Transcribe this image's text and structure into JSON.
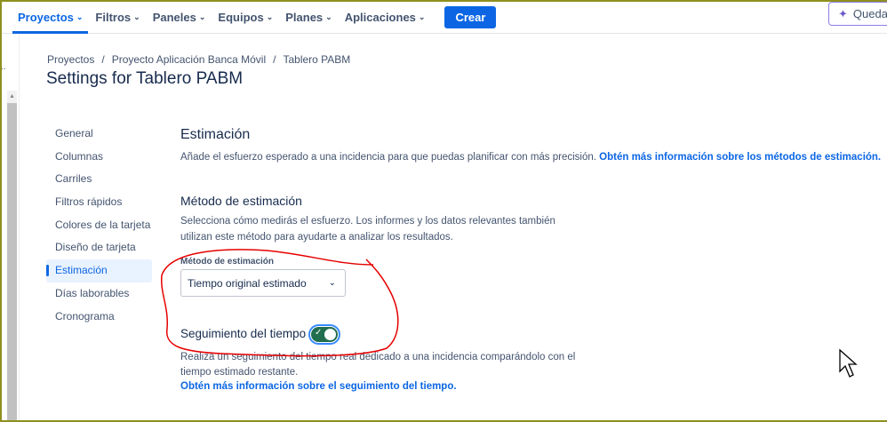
{
  "topnav": {
    "items": [
      {
        "label": "Proyectos",
        "active": true
      },
      {
        "label": "Filtros"
      },
      {
        "label": "Paneles"
      },
      {
        "label": "Equipos"
      },
      {
        "label": "Planes"
      },
      {
        "label": "Aplicaciones"
      }
    ],
    "create": "Crear",
    "quedar": "Quedar"
  },
  "breadcrumb": [
    "Proyectos",
    "Proyecto Aplicación Banca Móvil",
    "Tablero PABM"
  ],
  "title": "Settings for Tablero PABM",
  "sidebar": [
    "General",
    "Columnas",
    "Carriles",
    "Filtros rápidos",
    "Colores de la tarjeta",
    "Diseño de tarjeta",
    "Estimación",
    "Días laborables",
    "Cronograma"
  ],
  "main": {
    "heading": "Estimación",
    "intro": "Añade el esfuerzo esperado a una incidencia para que puedas planificar con más precisión.",
    "intro_link": "Obtén más información sobre los métodos de estimación.",
    "method_heading": "Método de estimación",
    "method_desc": "Selecciona cómo medirás el esfuerzo. Los informes y los datos relevantes también utilizan este método para ayudarte a analizar los resultados.",
    "select_label": "Método de estimación",
    "select_value": "Tiempo original estimado",
    "tracking_heading": "Seguimiento del tiempo",
    "tracking_on": true,
    "tracking_desc": "Realiza un seguimiento del tiempo real dedicado a una incidencia comparándolo con el tiempo estimado restante.",
    "tracking_link": "Obtén más información sobre el seguimiento del tiempo."
  },
  "colors": {
    "accent": "#0c66e4",
    "toggle": "#216e4e",
    "annotation": "#e60000"
  }
}
